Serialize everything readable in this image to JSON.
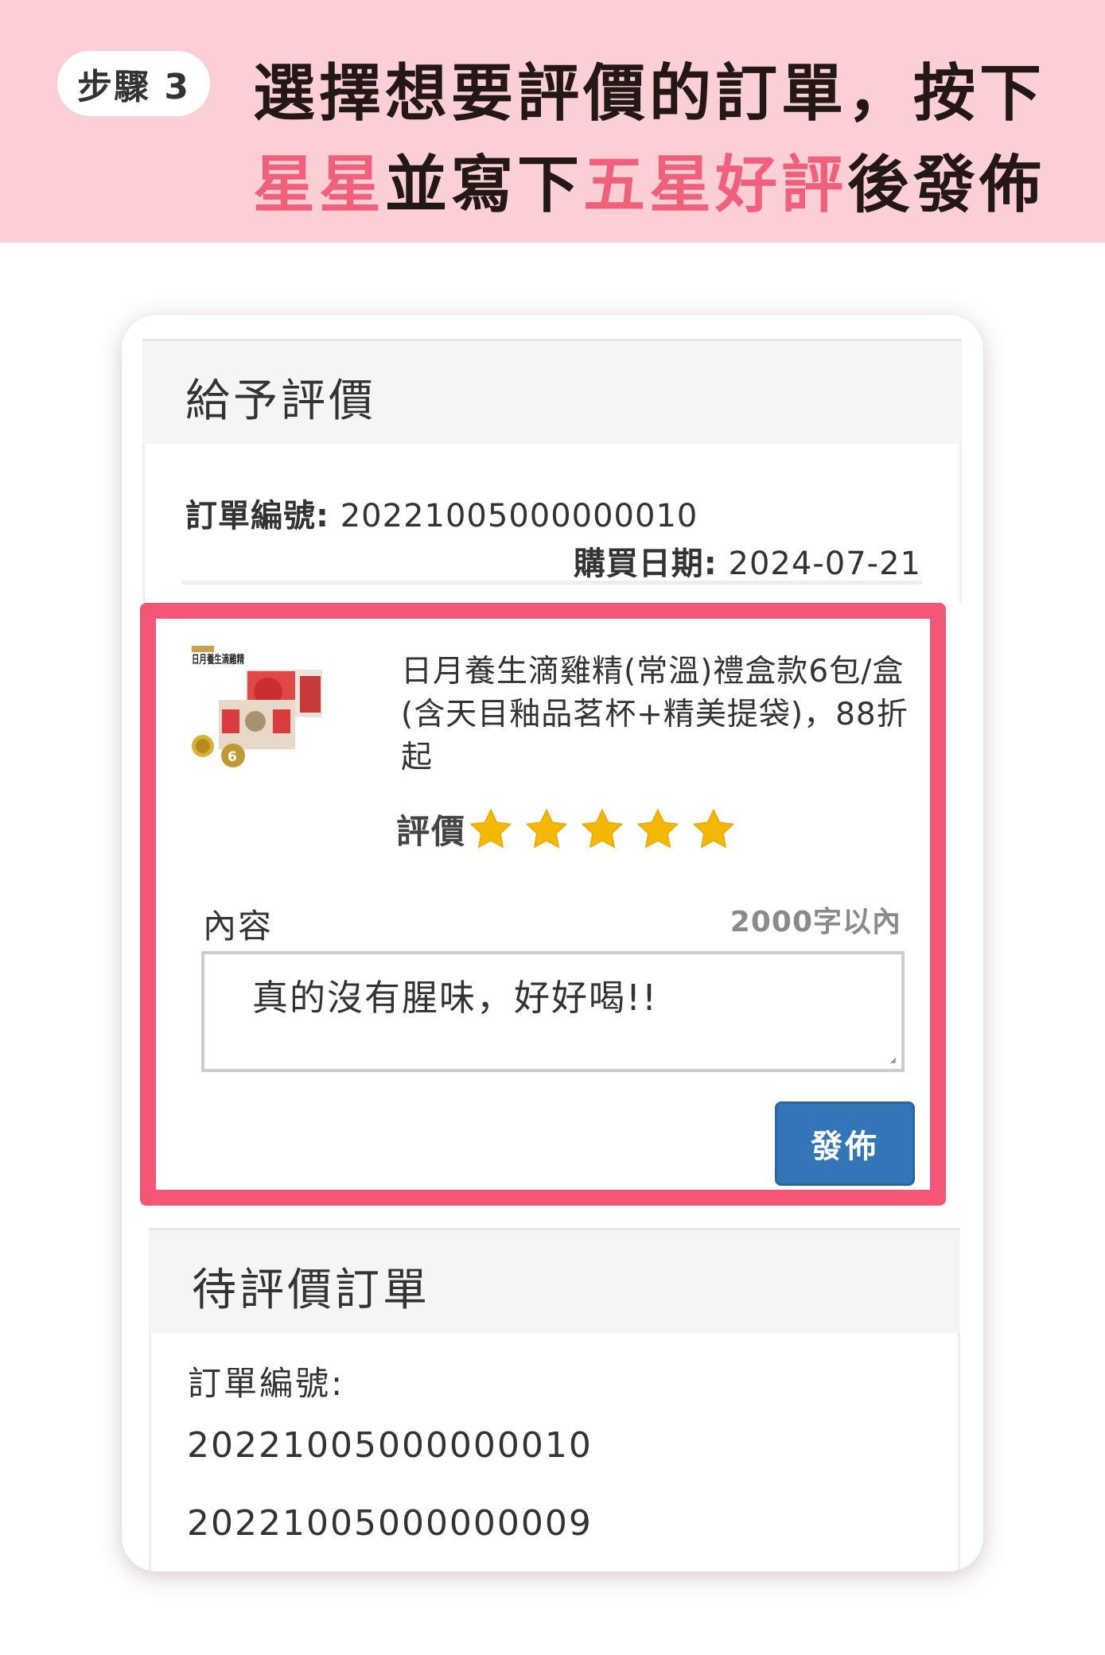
{
  "banner": {
    "step": "步驟 3",
    "line1": "選擇想要評價的訂單，按下",
    "line2_hl1": "星星",
    "line2_mid": "並寫下",
    "line2_hl2": "五星好評",
    "line2_end": "後發佈",
    "accent_color": "#f0607a",
    "bg_color": "#fbcfd3"
  },
  "review_panel": {
    "title": "給予評價",
    "order_label": "訂單編號:",
    "order_value": "20221005000000010",
    "date_label": "購買日期:",
    "date_value": "2024-07-21"
  },
  "product": {
    "image_icon": "product-gift-box-image",
    "thumb_text": "日月養生滴雞精",
    "name": "日月養生滴雞精(常溫)禮盒款6包/盒(含天目釉品茗杯+精美提袋)，88折起",
    "rating_label": "評價",
    "rating": 5,
    "star_icon": "star-icon",
    "star_color": "#f5b800"
  },
  "form": {
    "content_label": "內容",
    "limit_text": "2000字以內",
    "review_text": "真的沒有腥味，好好喝!!",
    "submit_label": "發佈",
    "submit_color": "#3276b8",
    "frame_color": "#f45677"
  },
  "pending": {
    "title": "待評價訂單",
    "order_label": "訂單編號:",
    "orders": [
      "20221005000000010",
      "20221005000000009"
    ]
  }
}
